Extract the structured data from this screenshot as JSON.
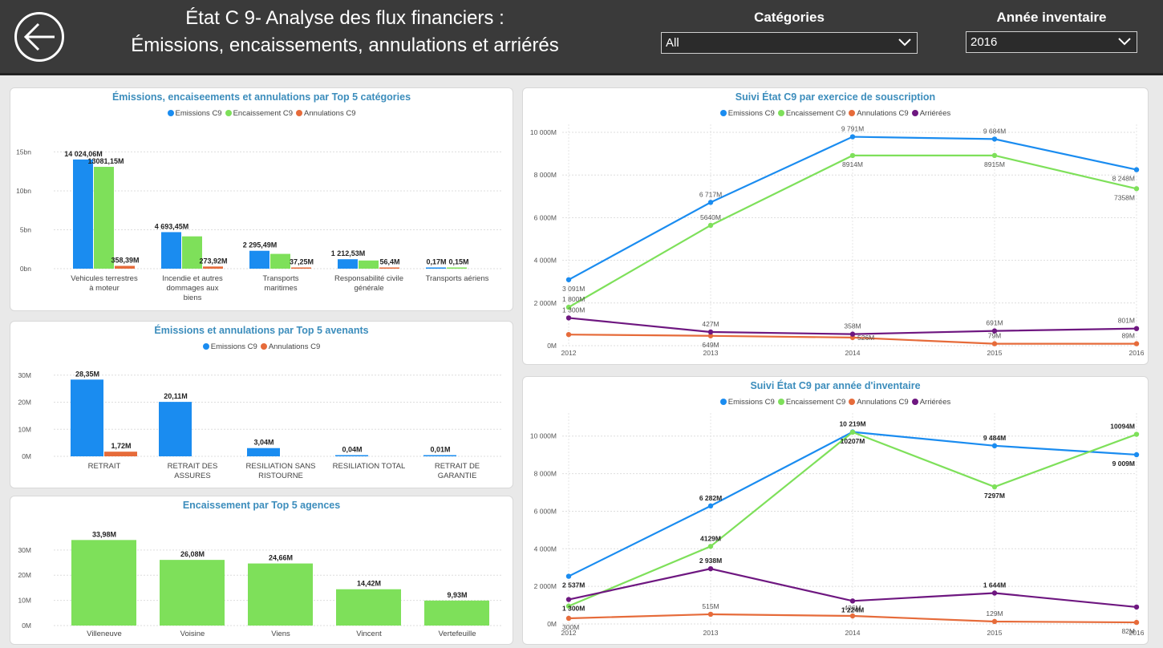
{
  "header": {
    "title_line1": "État C 9- Analyse des flux financiers :",
    "title_line2": "Émissions, encaissements, annulations et arriérés",
    "categories_label": "Catégories",
    "categories_value": "All",
    "year_label": "Année inventaire",
    "year_value": "2016"
  },
  "colors": {
    "emissions": "#1a8cf0",
    "encaissement": "#7ee05a",
    "annulations": "#e66b3a",
    "arrierees": "#6e1780"
  },
  "chart_data": [
    {
      "id": "top5-categories",
      "type": "bar",
      "title": "Émissions, encaiseements et annulations par Top 5 catégories",
      "categories": [
        "Vehicules terrestres\nà moteur",
        "Incendie et autres\ndommages aux\nbiens",
        "Transports\nmaritimes",
        "Responsabilité civile\ngénérale",
        "Transports aériens"
      ],
      "series": [
        {
          "name": "Emissions C9",
          "color": "#1a8cf0",
          "values": [
            14024.06,
            4693.45,
            2295.49,
            1212.53,
            0.17
          ],
          "labels": [
            "14 024,06M",
            "4 693,45M",
            "2 295,49M",
            "1 212,53M",
            "0,17M"
          ]
        },
        {
          "name": "Encaissement C9",
          "color": "#7ee05a",
          "values": [
            13081.15,
            4150,
            1900,
            1050,
            0.15
          ],
          "labels": [
            "13081,15M",
            "",
            "",
            "",
            "0,15M"
          ]
        },
        {
          "name": "Annulations C9",
          "color": "#e66b3a",
          "values": [
            358.39,
            273.92,
            37.25,
            56.4,
            0
          ],
          "labels": [
            "358,39M",
            "273,92M",
            "37,25M",
            "56,4M",
            ""
          ]
        }
      ],
      "yticks": [
        "0bn",
        "5bn",
        "10bn",
        "15bn"
      ],
      "ylim": [
        0,
        17000
      ]
    },
    {
      "id": "top5-avenants",
      "type": "bar",
      "title": "Émissions et annulations par Top 5 avenants",
      "categories": [
        "RETRAIT",
        "RETRAIT DES\nASSURES",
        "RESILIATION SANS\nRISTOURNE",
        "RESILIATION TOTAL",
        "RETRAIT DE\nGARANTIE"
      ],
      "series": [
        {
          "name": "Emissions C9",
          "color": "#1a8cf0",
          "values": [
            28.35,
            20.11,
            3.04,
            0.04,
            0.01
          ],
          "labels": [
            "28,35M",
            "20,11M",
            "3,04M",
            "0,04M",
            "0,01M"
          ]
        },
        {
          "name": "Annulations C9",
          "color": "#e66b3a",
          "values": [
            1.72,
            0,
            0,
            0,
            0
          ],
          "labels": [
            "1,72M",
            "",
            "",
            "",
            ""
          ]
        }
      ],
      "yticks": [
        "0M",
        "10M",
        "20M",
        "30M"
      ],
      "ylim": [
        0,
        32
      ]
    },
    {
      "id": "top5-agences",
      "type": "bar",
      "title": "Encaissement par Top 5 agences",
      "categories": [
        "Villeneuve",
        "Voisine",
        "Viens",
        "Vincent",
        "Vertefeuille"
      ],
      "series": [
        {
          "name": "",
          "color": "#7ee05a",
          "values": [
            33.98,
            26.08,
            24.66,
            14.42,
            9.93
          ],
          "labels": [
            "33,98M",
            "26,08M",
            "24,66M",
            "14,42M",
            "9,93M"
          ]
        }
      ],
      "yticks": [
        "0M",
        "10M",
        "20M",
        "30M"
      ],
      "ylim": [
        0,
        36
      ]
    },
    {
      "id": "suivi-exercice",
      "type": "line",
      "title": "Suivi État C9 par exercice de souscription",
      "x": [
        "2012",
        "2013",
        "2014",
        "2015",
        "2016"
      ],
      "series": [
        {
          "name": "Emissions C9",
          "color": "#1a8cf0",
          "values": [
            3091,
            6717,
            9791,
            9684,
            8248
          ],
          "labels": [
            "3 091M",
            "6 717M",
            "9 791M",
            "9 684M",
            "8 248M"
          ],
          "labelPos": [
            "below",
            "above",
            "above",
            "above",
            "below"
          ]
        },
        {
          "name": "Encaissement C9",
          "color": "#7ee05a",
          "values": [
            1800,
            5640,
            8914,
            8915,
            7358
          ],
          "labels": [
            "1 800M",
            "5640M",
            "8914M",
            "8915M",
            "7358M"
          ],
          "labelPos": [
            "above",
            "above",
            "below",
            "below",
            "below"
          ]
        },
        {
          "name": "Annulations C9",
          "color": "#e66b3a",
          "values": [
            520,
            460,
            380,
            90,
            90
          ],
          "labels": [
            "",
            "649M",
            "526M",
            "79M",
            "89M"
          ],
          "labelPos": [
            "above",
            "below",
            "right",
            "above",
            "above"
          ]
        },
        {
          "name": "Arriérées",
          "color": "#6e1780",
          "values": [
            1300,
            640,
            540,
            691,
            801
          ],
          "labels": [
            "1 300M",
            "427M",
            "358M",
            "691M",
            "801M"
          ],
          "labelPos": [
            "above",
            "above",
            "above",
            "above",
            "above"
          ]
        }
      ],
      "yticks": [
        "0M",
        "2 000M",
        "4 000M",
        "6 000M",
        "8 000M",
        "10 000M"
      ],
      "ylim": [
        0,
        10000
      ]
    },
    {
      "id": "suivi-inventaire",
      "type": "line",
      "title": "Suivi État C9 par année d'inventaire",
      "x": [
        "2012",
        "2013",
        "2014",
        "2015",
        "2016"
      ],
      "series": [
        {
          "name": "Emissions C9",
          "color": "#1a8cf0",
          "values": [
            2537,
            6282,
            10219,
            9484,
            9009
          ],
          "labels": [
            "2 537M",
            "6 282M",
            "10 219M",
            "9 484M",
            "9 009M"
          ],
          "labelPos": [
            "below",
            "above",
            "above",
            "above",
            "below"
          ]
        },
        {
          "name": "Encaissement C9",
          "color": "#7ee05a",
          "values": [
            950,
            4129,
            10207,
            7297,
            10094
          ],
          "labels": [
            "",
            "4129M",
            "10207M",
            "7297M",
            "10094M"
          ],
          "labelPos": [
            "above",
            "above",
            "below",
            "below",
            "above"
          ]
        },
        {
          "name": "Annulations C9",
          "color": "#e66b3a",
          "values": [
            300,
            515,
            426,
            129,
            82
          ],
          "labels": [
            "300M",
            "515M",
            "426M",
            "129M",
            "82M"
          ],
          "labelPos": [
            "below",
            "above",
            "above",
            "above",
            "below"
          ]
        },
        {
          "name": "Arriérées",
          "color": "#6e1780",
          "values": [
            1300,
            2938,
            1224,
            1644,
            900
          ],
          "labels": [
            "1 300M",
            "2 938M",
            "1 224M",
            "1 644M",
            ""
          ],
          "labelPos": [
            "below",
            "above",
            "below",
            "above",
            "above"
          ]
        }
      ],
      "yticks": [
        "0M",
        "2 000M",
        "4 000M",
        "6 000M",
        "8 000M",
        "10 000M"
      ],
      "ylim": [
        0,
        10800
      ]
    }
  ]
}
